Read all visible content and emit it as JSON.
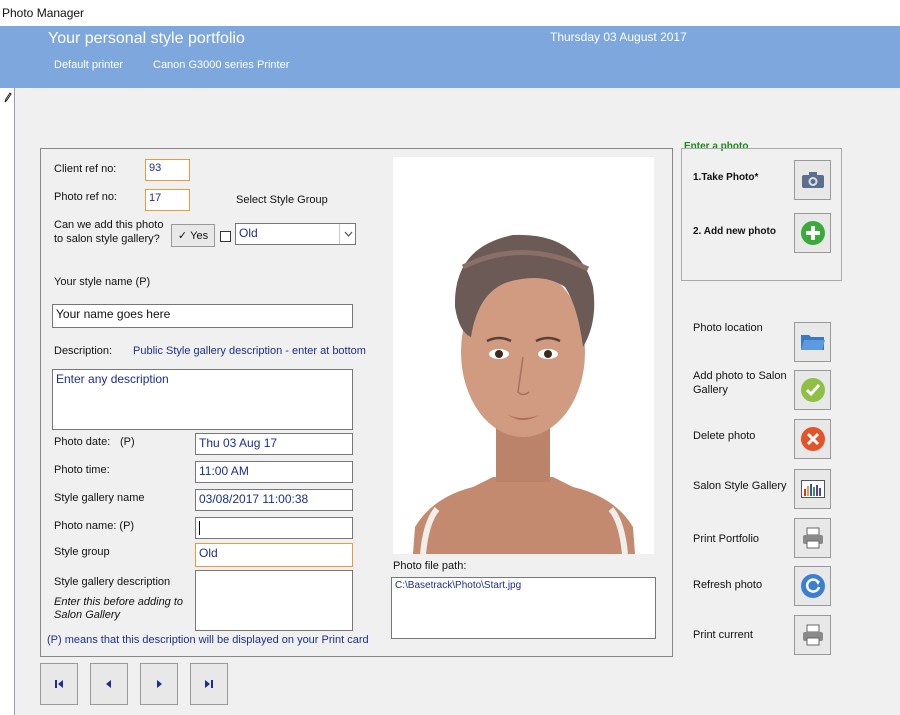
{
  "window": {
    "title": "Photo Manager"
  },
  "header": {
    "title": "Your personal style portfolio",
    "date": "Thursday 03 August 2017",
    "printer_label": "Default printer",
    "printer_value": "Canon G3000 series Printer"
  },
  "form": {
    "client_ref_label": "Client ref no:",
    "client_ref_value": "93",
    "photo_ref_label": "Photo ref no:",
    "photo_ref_value": "17",
    "select_style_group_label": "Select Style Group",
    "gallery_question_line1": "Can we add this photo",
    "gallery_question_line2": "to salon style gallery?",
    "yes_button_label": "Yes",
    "style_group_select_value": "Old",
    "style_name_label": "Your style name (P)",
    "style_name_value": "Your name goes here",
    "description_label": "Description:",
    "description_hint": "Public Style gallery description - enter at bottom",
    "description_value": "Enter any description",
    "photo_date_label": "Photo date:",
    "photo_date_p": "(P)",
    "photo_date_value": "Thu 03 Aug 17",
    "photo_time_label": "Photo time:",
    "photo_time_value": "11:00 AM",
    "gallery_name_label": "Style gallery name",
    "gallery_name_value": "03/08/2017 11:00:38",
    "photo_name_label": "Photo name: (P)",
    "photo_name_value": "",
    "style_group_label": "Style group",
    "style_group_value": "Old",
    "gallery_desc_label": "Style gallery description",
    "gallery_desc_hint_line1": "Enter this before adding to",
    "gallery_desc_hint_line2": "Salon Gallery",
    "gallery_desc_value": "",
    "print_note": "(P) means that this description will be displayed on your Print card",
    "photo_file_path_label": "Photo file path:",
    "photo_file_path_value": "C:\\Basetrack\\Photo\\Start.jpg"
  },
  "actions": {
    "enter_photo_label": "Enter a photo",
    "take_photo_label": "1.Take Photo*",
    "add_new_photo_label": "2. Add new photo",
    "photo_location_label": "Photo location",
    "add_to_gallery_line1": "Add photo to Salon",
    "add_to_gallery_line2": "Gallery",
    "delete_photo_label": "Delete photo",
    "salon_gallery_label": "Salon Style Gallery",
    "print_portfolio_label": "Print Portfolio",
    "refresh_photo_label": "Refresh photo",
    "print_current_label": "Print current"
  },
  "colors": {
    "header_bg": "#7da7dd",
    "accent_blue": "#1c2f8c",
    "field_orange": "#e89a3c",
    "green_label": "#1a8a1a"
  },
  "icons": [
    "pencil-icon",
    "camera-icon",
    "plus-icon",
    "folder-icon",
    "check-icon",
    "delete-icon",
    "chart-icon",
    "printer-icon",
    "refresh-icon",
    "first-icon",
    "prev-icon",
    "next-icon",
    "last-icon"
  ]
}
